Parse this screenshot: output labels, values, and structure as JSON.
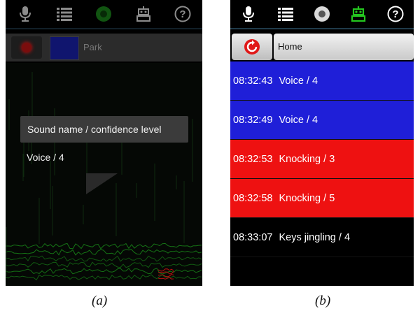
{
  "topbar": {
    "icons": [
      "microphone-icon",
      "list-icon",
      "record-disc-icon",
      "robot-icon",
      "help-icon"
    ],
    "help_glyph": "?"
  },
  "phone_a": {
    "toolbar": {
      "title": "Park",
      "swatch_color": "#10156e"
    },
    "tooltip": "Sound name / confidence level",
    "detected": "Voice / 4"
  },
  "phone_b": {
    "toolbar": {
      "title": "Home"
    },
    "events": [
      {
        "time": "08:32:43",
        "label": "Voice / 4",
        "color": "#1f1fd8"
      },
      {
        "time": "08:32:49",
        "label": "Voice / 4",
        "color": "#1f1fd8"
      },
      {
        "time": "08:32:53",
        "label": "Knocking / 3",
        "color": "#ee1111"
      },
      {
        "time": "08:32:58",
        "label": "Knocking / 5",
        "color": "#ee1111"
      },
      {
        "time": "08:33:07",
        "label": "Keys jingling / 4",
        "color": "#000000"
      }
    ]
  },
  "captions": {
    "a": "(a)",
    "b": "(b)"
  },
  "colors": {
    "accent_green": "#24c61f",
    "record_red": "#d01010"
  }
}
